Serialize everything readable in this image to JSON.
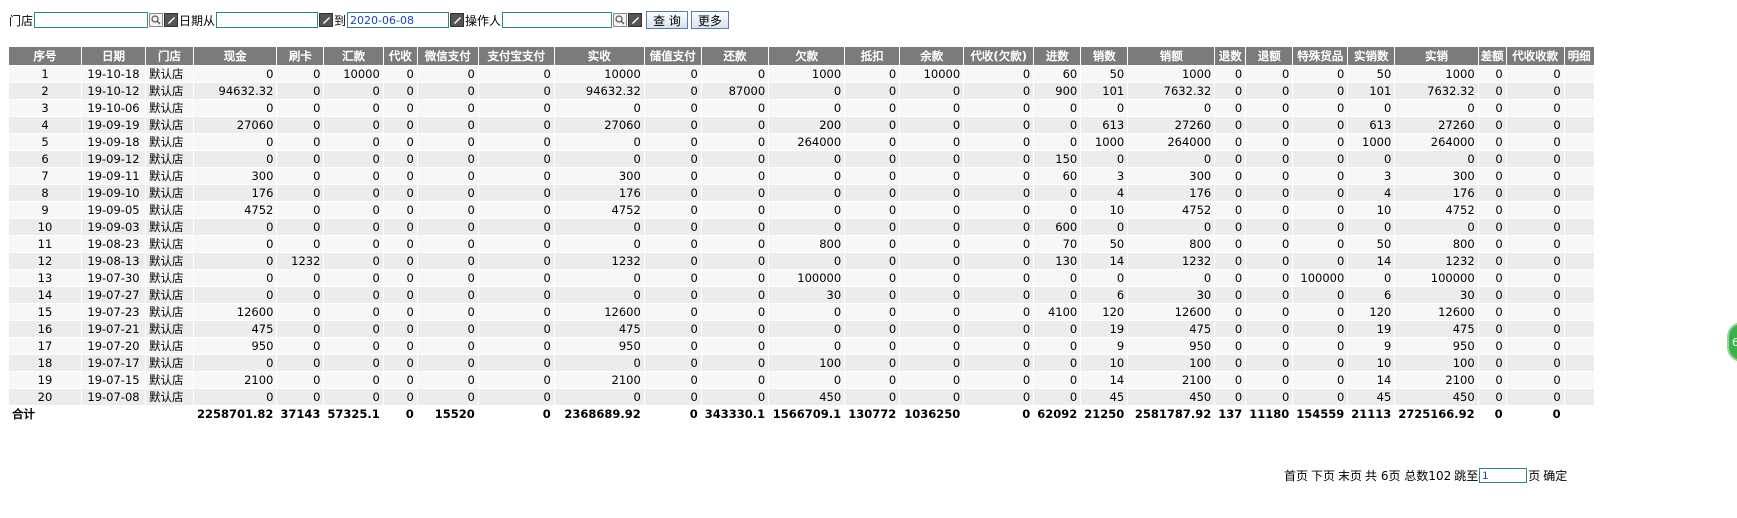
{
  "filters": {
    "store_label": "门店",
    "store_value": "",
    "date_from_label": "日期从",
    "date_from_value": "",
    "date_to_label": "到",
    "date_to_value": "2020-06-08",
    "operator_label": "操作人",
    "operator_value": "",
    "query_button": "查 询",
    "more_button": "更多"
  },
  "table": {
    "columns": [
      "序号",
      "日期",
      "门店",
      "现金",
      "刷卡",
      "汇款",
      "代收",
      "微信支付",
      "支付宝支付",
      "实收",
      "储值支付",
      "还款",
      "欠款",
      "抵扣",
      "余款",
      "代收(欠款)",
      "进数",
      "销数",
      "销额",
      "退数",
      "退额",
      "特殊货品",
      "实销数",
      "实销",
      "差额",
      "代收收款",
      "明细"
    ],
    "rows": [
      [
        "1",
        "19-10-18",
        "默认店",
        "0",
        "0",
        "10000",
        "0",
        "0",
        "0",
        "10000",
        "0",
        "0",
        "1000",
        "0",
        "10000",
        "0",
        "60",
        "50",
        "1000",
        "0",
        "0",
        "0",
        "50",
        "1000",
        "0",
        "0",
        ""
      ],
      [
        "2",
        "19-10-12",
        "默认店",
        "94632.32",
        "0",
        "0",
        "0",
        "0",
        "0",
        "94632.32",
        "0",
        "87000",
        "0",
        "0",
        "0",
        "0",
        "900",
        "101",
        "7632.32",
        "0",
        "0",
        "0",
        "101",
        "7632.32",
        "0",
        "0",
        ""
      ],
      [
        "3",
        "19-10-06",
        "默认店",
        "0",
        "0",
        "0",
        "0",
        "0",
        "0",
        "0",
        "0",
        "0",
        "0",
        "0",
        "0",
        "0",
        "0",
        "0",
        "0",
        "0",
        "0",
        "0",
        "0",
        "0",
        "0",
        "0",
        ""
      ],
      [
        "4",
        "19-09-19",
        "默认店",
        "27060",
        "0",
        "0",
        "0",
        "0",
        "0",
        "27060",
        "0",
        "0",
        "200",
        "0",
        "0",
        "0",
        "0",
        "613",
        "27260",
        "0",
        "0",
        "0",
        "613",
        "27260",
        "0",
        "0",
        ""
      ],
      [
        "5",
        "19-09-18",
        "默认店",
        "0",
        "0",
        "0",
        "0",
        "0",
        "0",
        "0",
        "0",
        "0",
        "264000",
        "0",
        "0",
        "0",
        "0",
        "1000",
        "264000",
        "0",
        "0",
        "0",
        "1000",
        "264000",
        "0",
        "0",
        ""
      ],
      [
        "6",
        "19-09-12",
        "默认店",
        "0",
        "0",
        "0",
        "0",
        "0",
        "0",
        "0",
        "0",
        "0",
        "0",
        "0",
        "0",
        "0",
        "150",
        "0",
        "0",
        "0",
        "0",
        "0",
        "0",
        "0",
        "0",
        "0",
        ""
      ],
      [
        "7",
        "19-09-11",
        "默认店",
        "300",
        "0",
        "0",
        "0",
        "0",
        "0",
        "300",
        "0",
        "0",
        "0",
        "0",
        "0",
        "0",
        "60",
        "3",
        "300",
        "0",
        "0",
        "0",
        "3",
        "300",
        "0",
        "0",
        ""
      ],
      [
        "8",
        "19-09-10",
        "默认店",
        "176",
        "0",
        "0",
        "0",
        "0",
        "0",
        "176",
        "0",
        "0",
        "0",
        "0",
        "0",
        "0",
        "0",
        "4",
        "176",
        "0",
        "0",
        "0",
        "4",
        "176",
        "0",
        "0",
        ""
      ],
      [
        "9",
        "19-09-05",
        "默认店",
        "4752",
        "0",
        "0",
        "0",
        "0",
        "0",
        "4752",
        "0",
        "0",
        "0",
        "0",
        "0",
        "0",
        "0",
        "10",
        "4752",
        "0",
        "0",
        "0",
        "10",
        "4752",
        "0",
        "0",
        ""
      ],
      [
        "10",
        "19-09-03",
        "默认店",
        "0",
        "0",
        "0",
        "0",
        "0",
        "0",
        "0",
        "0",
        "0",
        "0",
        "0",
        "0",
        "0",
        "600",
        "0",
        "0",
        "0",
        "0",
        "0",
        "0",
        "0",
        "0",
        "0",
        ""
      ],
      [
        "11",
        "19-08-23",
        "默认店",
        "0",
        "0",
        "0",
        "0",
        "0",
        "0",
        "0",
        "0",
        "0",
        "800",
        "0",
        "0",
        "0",
        "70",
        "50",
        "800",
        "0",
        "0",
        "0",
        "50",
        "800",
        "0",
        "0",
        ""
      ],
      [
        "12",
        "19-08-13",
        "默认店",
        "0",
        "1232",
        "0",
        "0",
        "0",
        "0",
        "1232",
        "0",
        "0",
        "0",
        "0",
        "0",
        "0",
        "130",
        "14",
        "1232",
        "0",
        "0",
        "0",
        "14",
        "1232",
        "0",
        "0",
        ""
      ],
      [
        "13",
        "19-07-30",
        "默认店",
        "0",
        "0",
        "0",
        "0",
        "0",
        "0",
        "0",
        "0",
        "0",
        "100000",
        "0",
        "0",
        "0",
        "0",
        "0",
        "0",
        "0",
        "0",
        "100000",
        "0",
        "100000",
        "0",
        "0",
        ""
      ],
      [
        "14",
        "19-07-27",
        "默认店",
        "0",
        "0",
        "0",
        "0",
        "0",
        "0",
        "0",
        "0",
        "0",
        "30",
        "0",
        "0",
        "0",
        "0",
        "6",
        "30",
        "0",
        "0",
        "0",
        "6",
        "30",
        "0",
        "0",
        ""
      ],
      [
        "15",
        "19-07-23",
        "默认店",
        "12600",
        "0",
        "0",
        "0",
        "0",
        "0",
        "12600",
        "0",
        "0",
        "0",
        "0",
        "0",
        "0",
        "4100",
        "120",
        "12600",
        "0",
        "0",
        "0",
        "120",
        "12600",
        "0",
        "0",
        ""
      ],
      [
        "16",
        "19-07-21",
        "默认店",
        "475",
        "0",
        "0",
        "0",
        "0",
        "0",
        "475",
        "0",
        "0",
        "0",
        "0",
        "0",
        "0",
        "0",
        "19",
        "475",
        "0",
        "0",
        "0",
        "19",
        "475",
        "0",
        "0",
        ""
      ],
      [
        "17",
        "19-07-20",
        "默认店",
        "950",
        "0",
        "0",
        "0",
        "0",
        "0",
        "950",
        "0",
        "0",
        "0",
        "0",
        "0",
        "0",
        "0",
        "9",
        "950",
        "0",
        "0",
        "0",
        "9",
        "950",
        "0",
        "0",
        ""
      ],
      [
        "18",
        "19-07-17",
        "默认店",
        "0",
        "0",
        "0",
        "0",
        "0",
        "0",
        "0",
        "0",
        "0",
        "100",
        "0",
        "0",
        "0",
        "0",
        "10",
        "100",
        "0",
        "0",
        "0",
        "10",
        "100",
        "0",
        "0",
        ""
      ],
      [
        "19",
        "19-07-15",
        "默认店",
        "2100",
        "0",
        "0",
        "0",
        "0",
        "0",
        "2100",
        "0",
        "0",
        "0",
        "0",
        "0",
        "0",
        "0",
        "14",
        "2100",
        "0",
        "0",
        "0",
        "14",
        "2100",
        "0",
        "0",
        ""
      ],
      [
        "20",
        "19-07-08",
        "默认店",
        "0",
        "0",
        "0",
        "0",
        "0",
        "0",
        "0",
        "0",
        "0",
        "450",
        "0",
        "0",
        "0",
        "0",
        "45",
        "450",
        "0",
        "0",
        "0",
        "45",
        "450",
        "0",
        "0",
        ""
      ]
    ],
    "total": [
      "合计",
      "",
      "",
      "2258701.82",
      "37143",
      "57325.1",
      "0",
      "15520",
      "0",
      "2368689.92",
      "0",
      "343330.1",
      "1566709.1",
      "130772",
      "1036250",
      "0",
      "62092",
      "21250",
      "2581787.92",
      "137",
      "11180",
      "154559",
      "21113",
      "2725166.92",
      "0",
      "0",
      ""
    ]
  },
  "pager": {
    "first": "首页",
    "next": "下页",
    "last": "末页",
    "summary": "共 6页 总数102",
    "jump_label": "跳至",
    "page_value": "1",
    "page_unit": "页",
    "confirm": "确定"
  },
  "float_badge": "6"
}
